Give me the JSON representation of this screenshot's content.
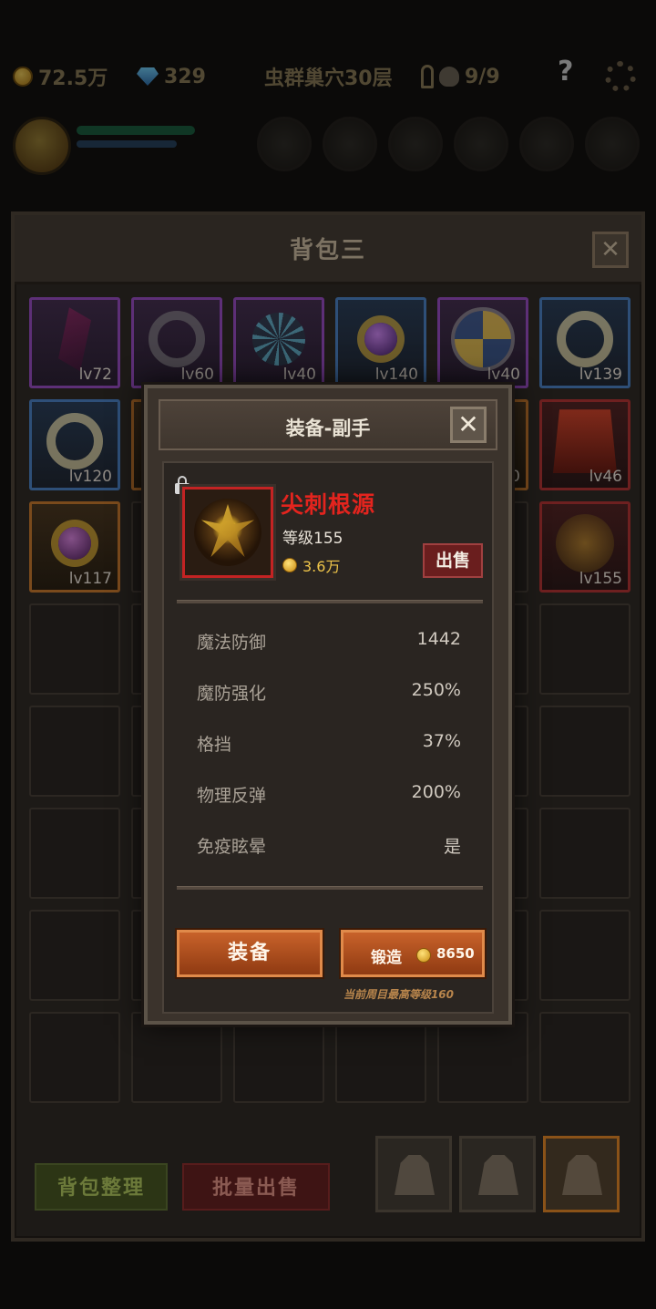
{
  "topbar": {
    "gold": "72.5万",
    "gems": "329",
    "location": "虫群巢穴30层",
    "keys": "9/9",
    "help": "?"
  },
  "bag": {
    "title": "背包三",
    "close": "✕",
    "slots": [
      {
        "rarity": "purple",
        "icon": "claw",
        "level": "lv72"
      },
      {
        "rarity": "purple",
        "icon": "dark-ring",
        "level": "lv60"
      },
      {
        "rarity": "purple",
        "icon": "net",
        "level": "lv40"
      },
      {
        "rarity": "blue",
        "icon": "amulet",
        "level": "lv140"
      },
      {
        "rarity": "purple",
        "icon": "shield",
        "level": "lv40"
      },
      {
        "rarity": "blue",
        "icon": "ring",
        "level": "lv139"
      },
      {
        "rarity": "blue",
        "icon": "ring",
        "level": "lv120"
      },
      {
        "rarity": "orange",
        "icon": "amulet",
        "level": ""
      },
      {
        "rarity": "",
        "icon": "",
        "level": ""
      },
      {
        "rarity": "",
        "icon": "",
        "level": ""
      },
      {
        "rarity": "orange",
        "icon": "",
        "level": "0"
      },
      {
        "rarity": "red",
        "icon": "cape",
        "level": "lv46"
      },
      {
        "rarity": "orange",
        "icon": "amulet",
        "level": "lv117"
      },
      {
        "rarity": "",
        "icon": "",
        "level": ""
      },
      {
        "rarity": "",
        "icon": "",
        "level": ""
      },
      {
        "rarity": "",
        "icon": "",
        "level": ""
      },
      {
        "rarity": "",
        "icon": "",
        "level": ""
      },
      {
        "rarity": "red",
        "icon": "spike",
        "level": "lv155"
      }
    ],
    "sort_label": "背包整理",
    "batch_sell_label": "批量出售",
    "tabs": [
      "bag-1",
      "bag-2",
      "bag-3"
    ],
    "active_tab": 2
  },
  "modal": {
    "title": "装备-副手",
    "close": "✕",
    "item": {
      "name": "尖刺根源",
      "level": "等级155",
      "price": "3.6万",
      "locked": true
    },
    "sell_label": "出售",
    "stats": [
      {
        "name": "魔法防御",
        "value": "1442"
      },
      {
        "name": "魔防强化",
        "value": "250%"
      },
      {
        "name": "格挡",
        "value": "37%"
      },
      {
        "name": "物理反弹",
        "value": "200%"
      },
      {
        "name": "免疫眩晕",
        "value": "是"
      }
    ],
    "equip_label": "装备",
    "forge_label": "锻造",
    "forge_cost": "8650",
    "note": "当前周目最高等级160"
  },
  "colors": {
    "item_name": "#e3241e",
    "gold": "#f0c64a",
    "action_button": "#c8622a",
    "sell_button": "#6a1e1e"
  }
}
